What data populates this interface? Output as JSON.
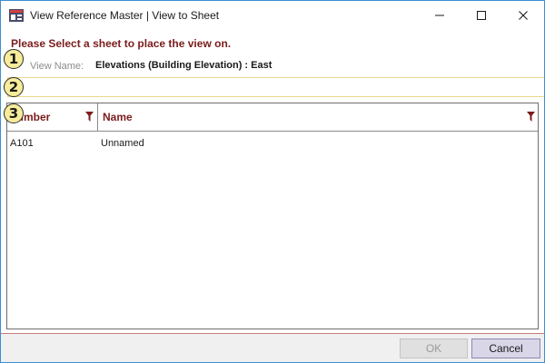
{
  "window": {
    "title": "View Reference Master | View to Sheet",
    "accent_color": "#7b1c1c"
  },
  "prompt": "Please Select a sheet to place the view on.",
  "view_name": {
    "label": "View Name:",
    "value": "Elevations (Building Elevation) : East"
  },
  "badges": [
    "1",
    "2",
    "3"
  ],
  "filter": {
    "value": "",
    "placeholder": ""
  },
  "grid": {
    "columns": [
      "Number",
      "Name"
    ],
    "rows": [
      {
        "number": "A101",
        "name": "Unnamed"
      }
    ]
  },
  "buttons": {
    "ok": "OK",
    "cancel": "Cancel"
  }
}
